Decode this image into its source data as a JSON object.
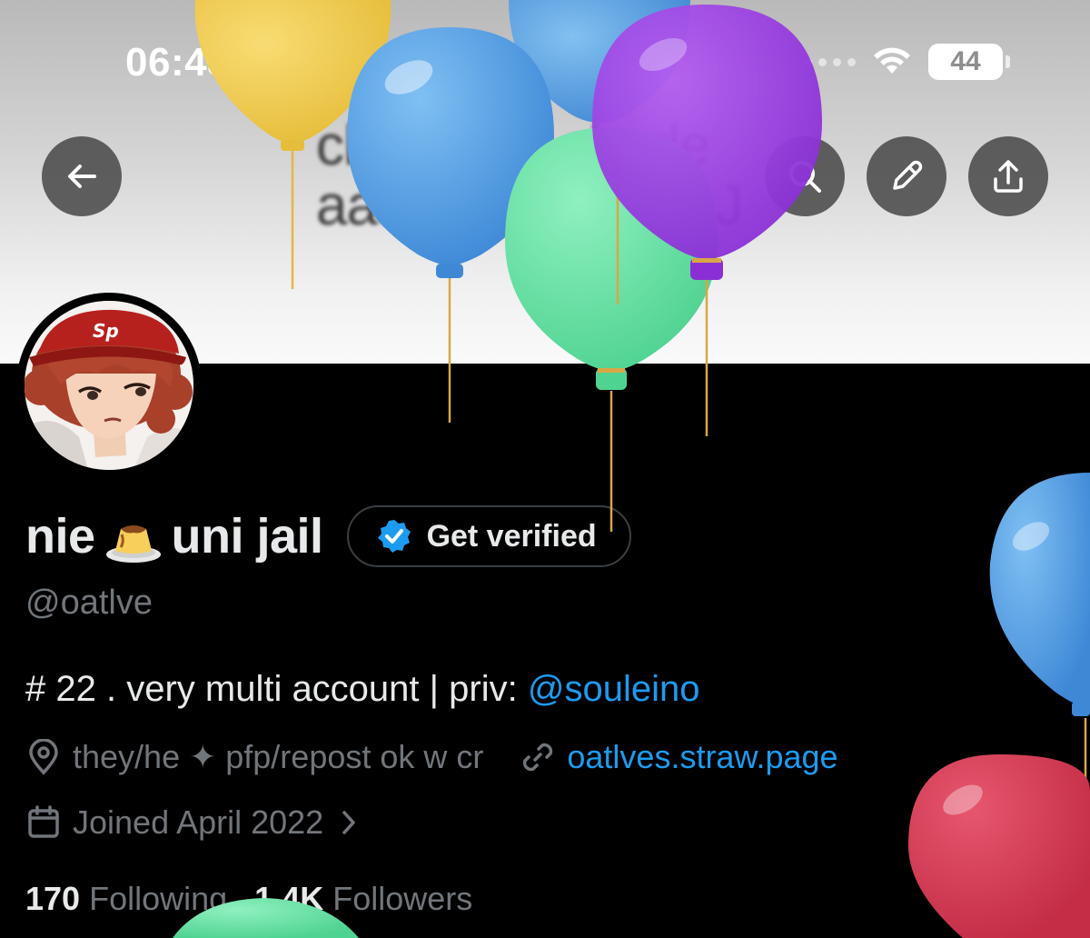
{
  "status_bar": {
    "time": "06:43",
    "battery": "44"
  },
  "banner": {
    "text_line1": "christian   charle",
    "text_line2": "aaaaahHGHJKLJ"
  },
  "nav": {
    "back_icon": "arrow-left-icon",
    "search_icon": "search-icon",
    "edit_icon": "pencil-icon",
    "share_icon": "share-icon"
  },
  "profile": {
    "name_part1": "nie",
    "name_emoji": "flan-emoji",
    "name_part2": "uni jail",
    "verify_label": "Get verified",
    "handle": "@oatlve",
    "bio_text": "# 22 . very multi account | priv: ",
    "bio_mention": "@souleino",
    "location": "they/he ✦ pfp/repost ok w cr",
    "website": "oatlves.straw.page",
    "joined": "Joined April 2022",
    "following_count": "170",
    "following_label": "Following",
    "followers_count": "1.4K",
    "followers_label": "Followers"
  },
  "colors": {
    "accent": "#1d9bf0",
    "muted": "#71767b",
    "text": "#e7e9ea"
  }
}
